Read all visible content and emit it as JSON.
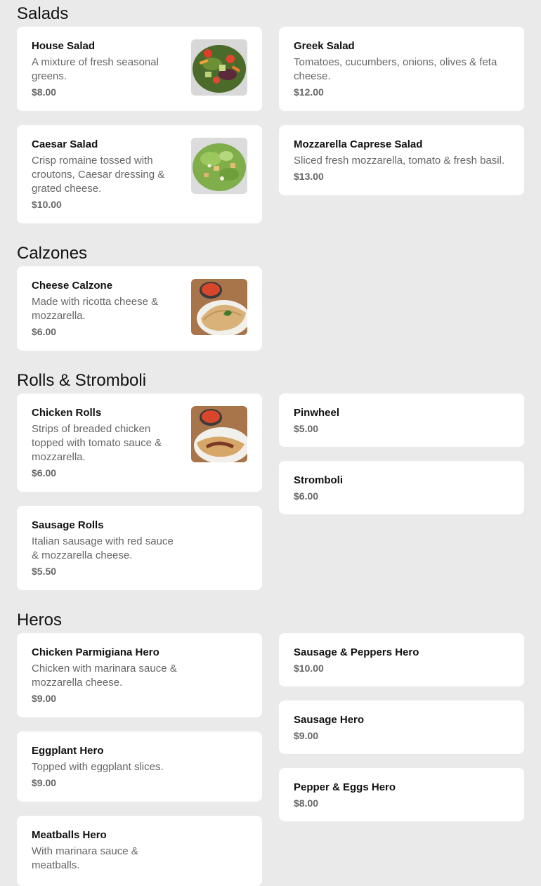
{
  "sections": {
    "salads": {
      "title": "Salads",
      "items": [
        {
          "name": "House Salad",
          "desc": "A mixture of fresh seasonal greens.",
          "price": "$8.00",
          "photo": "house-salad-photo"
        },
        {
          "name": "Greek Salad",
          "desc": "Tomatoes, cucumbers, onions, olives & feta cheese.",
          "price": "$12.00"
        },
        {
          "name": "Caesar Salad",
          "desc": "Crisp romaine tossed with croutons, Caesar dressing & grated cheese.",
          "price": "$10.00",
          "photo": "caesar-salad-photo"
        },
        {
          "name": "Mozzarella Caprese Salad",
          "desc": "Sliced fresh mozzarella, tomato & fresh basil.",
          "price": "$13.00"
        }
      ]
    },
    "calzones": {
      "title": "Calzones",
      "items": [
        {
          "name": "Cheese Calzone",
          "desc": "Made with ricotta cheese & mozzarella.",
          "price": "$6.00",
          "photo": "cheese-calzone-photo"
        }
      ]
    },
    "rolls": {
      "title": "Rolls & Stromboli",
      "items": [
        {
          "name": "Chicken Rolls",
          "desc": "Strips of breaded chicken topped with tomato sauce & mozzarella.",
          "price": "$6.00",
          "photo": "chicken-rolls-photo"
        },
        {
          "name": "Pinwheel",
          "price": "$5.00"
        },
        {
          "name": "Stromboli",
          "price": "$6.00"
        },
        {
          "name": "Sausage Rolls",
          "desc": "Italian sausage with red sauce & mozzarella cheese.",
          "price": "$5.50"
        }
      ]
    },
    "heros": {
      "title": "Heros",
      "items": [
        {
          "name": "Chicken Parmigiana Hero",
          "desc": "Chicken with marinara sauce & mozzarella cheese.",
          "price": "$9.00"
        },
        {
          "name": "Sausage & Peppers Hero",
          "price": "$10.00"
        },
        {
          "name": "Sausage Hero",
          "price": "$9.00"
        },
        {
          "name": "Eggplant Hero",
          "desc": "Topped with eggplant slices.",
          "price": "$9.00"
        },
        {
          "name": "Pepper & Eggs Hero",
          "price": "$8.00"
        },
        {
          "name": "Meatballs Hero",
          "desc": "With marinara sauce & meatballs."
        }
      ]
    }
  }
}
